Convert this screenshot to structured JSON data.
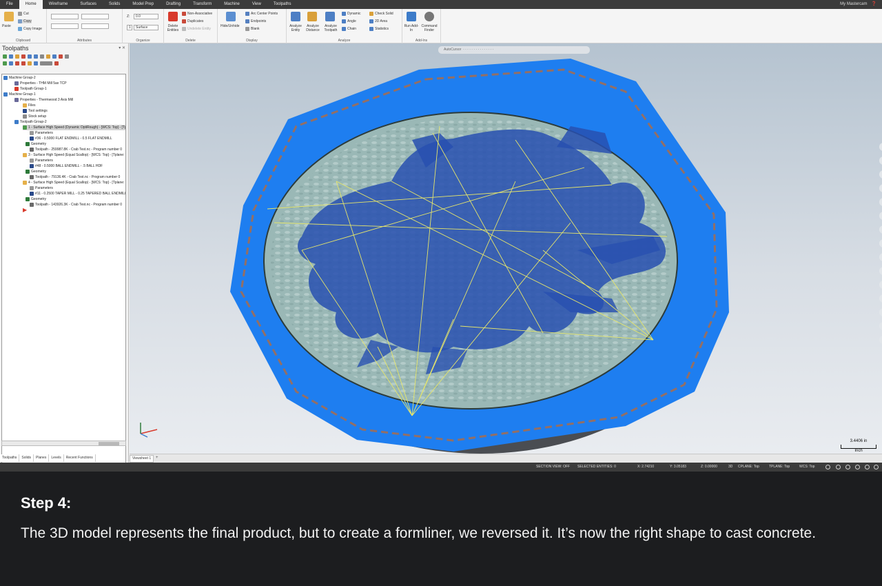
{
  "menu": {
    "tabs": [
      "File",
      "Home",
      "Wireframe",
      "Surfaces",
      "Solids",
      "Model Prep",
      "Drafting",
      "Transform",
      "Machine",
      "View",
      "Toolpaths"
    ],
    "active": "Home",
    "account": "My Mastercam"
  },
  "ribbon": {
    "clipboard": {
      "label": "Clipboard",
      "paste": "Paste",
      "cut": "Cut",
      "copy": "Copy",
      "copy_image": "Copy Image"
    },
    "attributes": {
      "label": "Attributes"
    },
    "organize": {
      "label": "Organize",
      "z_label": "Z:",
      "z_value": "0.0",
      "level_value": "1",
      "plane_value": "Surface"
    },
    "delete": {
      "label": "Delete",
      "delete_entities": "Delete Entities",
      "non_associative": "Non-Associative",
      "duplicates": "Duplicates",
      "undelete": "Undelete Entity"
    },
    "display": {
      "label": "Display",
      "hide_unhide": "Hide/Unhide",
      "arc_center_points": "Arc Center Points",
      "endpoints": "Endpoints",
      "blank": "Blank"
    },
    "analyze": {
      "label": "Analyze",
      "analyze_entity": "Analyze Entity",
      "analyze_distance": "Analyze Distance",
      "analyze_toolpath": "Analyze Toolpath",
      "dynamic": "Dynamic",
      "angle": "Angle",
      "chain": "Chain",
      "check_solid": "Check Solid",
      "area_2d": "2D Area",
      "statistics": "Statistics"
    },
    "addins": {
      "label": "Add-Ins",
      "run_addin": "Run Add-In",
      "command_finder": "Command Finder"
    }
  },
  "panel": {
    "title": "Toolpaths",
    "tree": [
      "Machine Group-2",
      "Properties - THM Mill 5ax TCP",
      "Toolpath Group-1",
      "Machine Group-1",
      "Properties - Thermwood 3 Axis Mill",
      "Files",
      "Tool settings",
      "Stock setup",
      "Toolpath Group-2",
      "1 - Surface High Speed (Dynamic OptiRough) - [WCS: Top] - [Tplane: Top]",
      "Parameters",
      "#36 - 0.5000 FLAT ENDMILL - 0.5 FLAT ENDMILL",
      "Geometry",
      "Toolpath - 259987.8K - Crab Test.nc - Program number 0",
      "3 - Surface High Speed (Equal Scallop) - [WCS: Top] - [Tplane: Top]",
      "Parameters",
      "#48 - 0.5000 BALL ENDMILL - .5 BALL HDF",
      "Geometry",
      "Toolpath - 79136.4K - Crab Test.nc - Program number 0",
      "4 - Surface High Speed (Equal Scallop) - [WCS: Top] - [Tplane: Top]",
      "Parameters",
      "#11 - 0.2500 TAPER MILL - 0.25 TAPERED BALL ENDMILL",
      "Geometry",
      "Toolpath - 143926.3K - Crab Test.nc - Program number 0"
    ],
    "tabs": [
      "Toolpaths",
      "Solids",
      "Planes",
      "Levels",
      "Recent Functions"
    ]
  },
  "viewport": {
    "toolbar_text": "AutoCursor",
    "scale_value": "3.4406 in",
    "scale_unit": "Inch",
    "sheet": "Viewsheet 1",
    "sheet_add": "+"
  },
  "status": {
    "section_view": "SECTION VIEW: OFF",
    "selected": "SELECTED ENTITIES: 0",
    "x": "X:  2.74210",
    "y": "Y:  3.05183",
    "z": "Z:  0.00000",
    "mode": "3D",
    "cplane": "CPLANE: Top",
    "tplane": "TPLANE: Top",
    "wcs": "WCS: Top"
  },
  "caption": {
    "title": "Step 4:",
    "body": "The 3D model represents the final product, but to create a formliner, we reversed it. It’s now the right shape to cast concrete."
  },
  "colors": {
    "toolpath_blue": "#1e7ef0",
    "toolpath_orange": "#c46a2a",
    "stock_surface": "#9ab8b6",
    "rapid_yellow": "#e7e66a"
  }
}
